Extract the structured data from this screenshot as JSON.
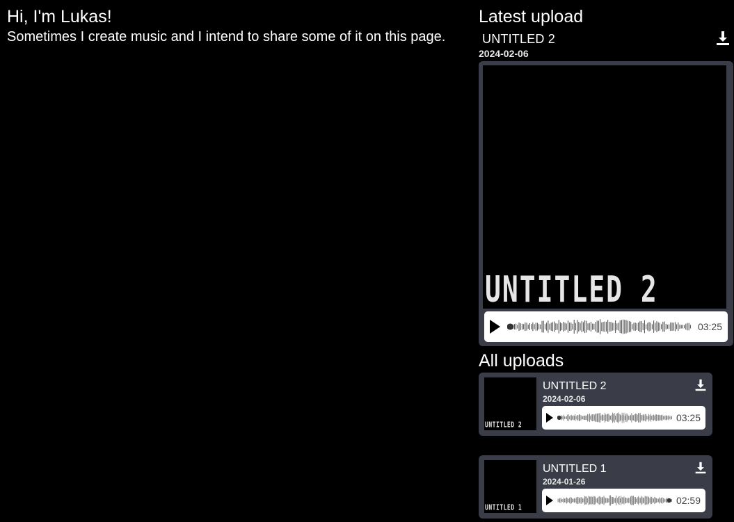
{
  "intro": {
    "greeting": "Hi, I'm Lukas!",
    "description": "Sometimes I create music and I intend to share some of it on this page."
  },
  "latest": {
    "heading": "Latest upload",
    "title": "UNTITLED 2",
    "date": "2024-02-06",
    "cover_text": "UNTITLED 2",
    "duration": "03:25",
    "icons": {
      "download": "download-icon",
      "play": "play-icon"
    }
  },
  "all": {
    "heading": "All uploads",
    "tracks": [
      {
        "title": "UNTITLED 2",
        "date": "2024-02-06",
        "cover_text": "UNTITLED 2",
        "duration": "03:25",
        "progress": 0.0
      },
      {
        "title": "UNTITLED 1",
        "date": "2024-01-26",
        "cover_text": "UNTITLED 1",
        "duration": "02:59",
        "progress": 1.0
      }
    ]
  },
  "colors": {
    "background": "#000000",
    "card": "#3a3d47",
    "player": "#ffffff",
    "waveform": "#555555",
    "text": "#ffffff"
  }
}
